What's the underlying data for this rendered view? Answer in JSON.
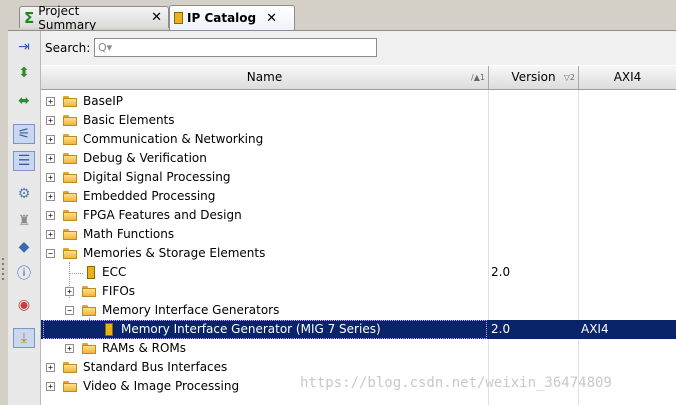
{
  "tabs": [
    {
      "label": "Project Summary",
      "close": "✕",
      "icon": "sigma-icon"
    },
    {
      "label": "IP Catalog",
      "close": "✕",
      "icon": "chip-icon"
    }
  ],
  "search": {
    "label": "Search:",
    "placeholder": "",
    "icon_glyph": "Q▾"
  },
  "columns": {
    "name": "Name",
    "name_sort": "1",
    "version": "Version",
    "version_sort": "2",
    "interface": "AXI4"
  },
  "tree": [
    {
      "label": "BaseIP"
    },
    {
      "label": "Basic Elements"
    },
    {
      "label": "Communication & Networking"
    },
    {
      "label": "Debug & Verification"
    },
    {
      "label": "Digital Signal Processing"
    },
    {
      "label": "Embedded Processing"
    },
    {
      "label": "FPGA Features and Design"
    },
    {
      "label": "Math Functions"
    },
    {
      "label": "Memories & Storage Elements"
    },
    {
      "label": "ECC",
      "version": "2.0"
    },
    {
      "label": "FIFOs"
    },
    {
      "label": "Memory Interface Generators"
    },
    {
      "label": "Memory Interface Generator (MIG 7 Series)",
      "version": "2.0",
      "interface": "AXI4",
      "selected": true
    },
    {
      "label": "RAMs & ROMs"
    },
    {
      "label": "Standard Bus Interfaces"
    },
    {
      "label": "Video & Image Processing"
    }
  ],
  "watermark": "https://blog.csdn.net/weixin_36474809"
}
